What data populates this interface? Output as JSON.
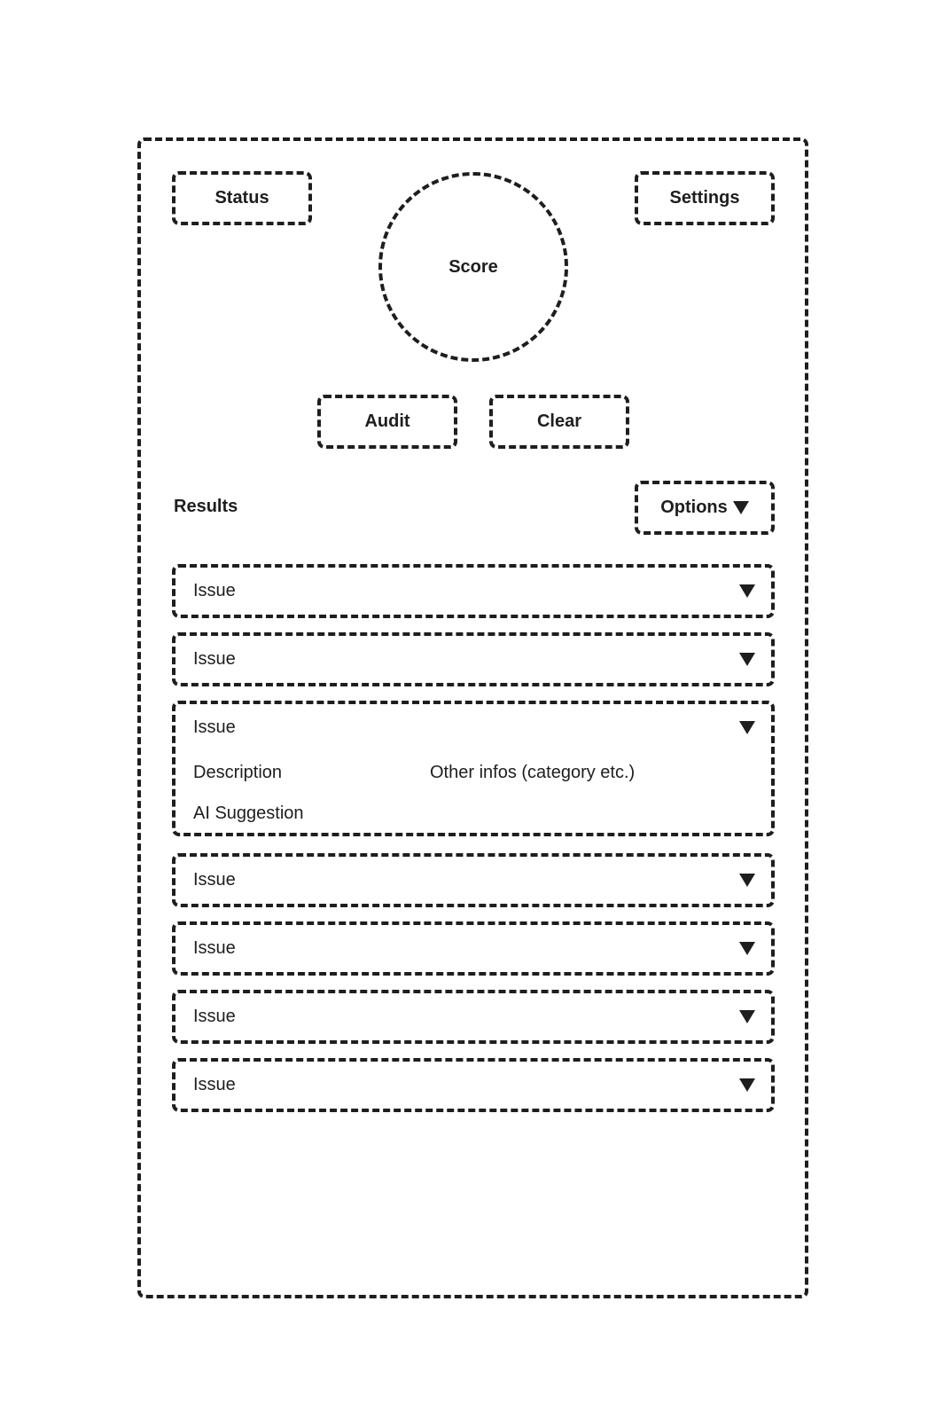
{
  "header": {
    "status_label": "Status",
    "settings_label": "Settings",
    "score_label": "Score"
  },
  "actions": {
    "audit_label": "Audit",
    "clear_label": "Clear"
  },
  "results": {
    "heading": "Results",
    "options_label": "Options",
    "issues": [
      {
        "label": "Issue",
        "expanded": false
      },
      {
        "label": "Issue",
        "expanded": false
      },
      {
        "label": "Issue",
        "expanded": true,
        "description_label": "Description",
        "other_info_label": "Other infos (category etc.)",
        "ai_suggestion_label": "AI Suggestion"
      },
      {
        "label": "Issue",
        "expanded": false
      },
      {
        "label": "Issue",
        "expanded": false
      },
      {
        "label": "Issue",
        "expanded": false
      },
      {
        "label": "Issue",
        "expanded": false
      }
    ]
  },
  "icons": {
    "dropdown": "triangle-down-icon"
  },
  "colors": {
    "stroke": "#1e1e1e",
    "background": "#ffffff"
  }
}
